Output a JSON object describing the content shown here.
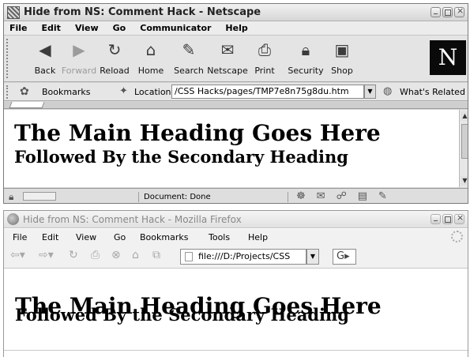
{
  "netscape": {
    "title": "Hide from NS: Comment Hack - Netscape",
    "menu": [
      "File",
      "Edit",
      "View",
      "Go",
      "Communicator",
      "Help"
    ],
    "toolbar": {
      "back": "Back",
      "forward": "Forward",
      "reload": "Reload",
      "home": "Home",
      "search": "Search",
      "netscape": "Netscape",
      "print": "Print",
      "security": "Security",
      "shop": "Shop"
    },
    "logo_letter": "N",
    "bookmarks_label": "Bookmarks",
    "location_label": "Location:",
    "location_value": "/CSS Hacks/pages/TMP7e8n75g8du.htm",
    "whats_related": "What's Related",
    "heading_main": "The Main Heading Goes Here",
    "heading_secondary": "Followed By the Secondary Heading",
    "status_text": "Document: Done"
  },
  "firefox": {
    "title": "Hide from NS: Comment Hack - Mozilla Firefox",
    "menu": [
      "File",
      "Edit",
      "View",
      "Go",
      "Bookmarks",
      "Tools",
      "Help"
    ],
    "url": "file:///D:/Projects/CSS",
    "heading_main": "The Main Heading Goes Here",
    "heading_secondary": "Followed By the Secondary Heading"
  }
}
